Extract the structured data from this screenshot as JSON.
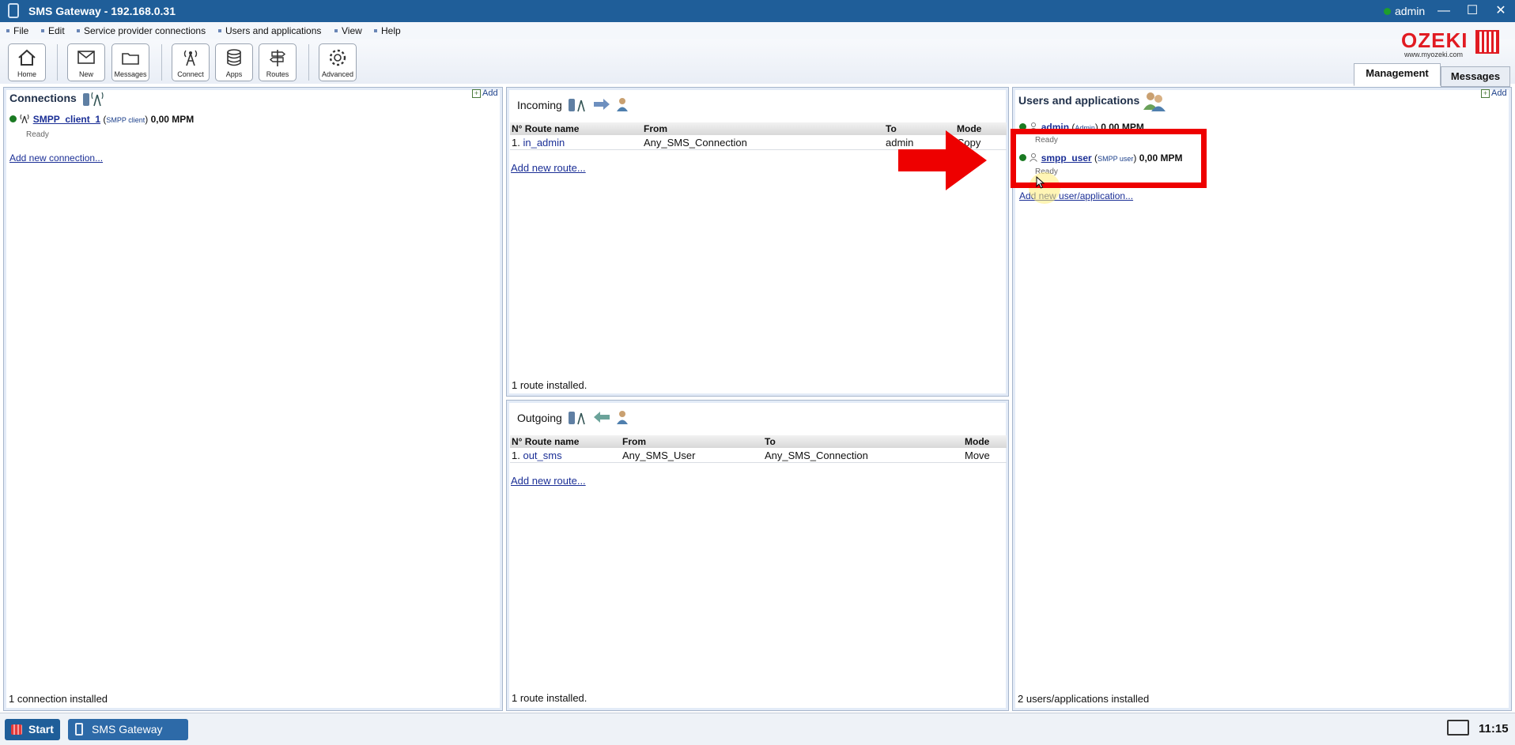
{
  "window": {
    "title": "SMS Gateway - 192.168.0.31",
    "user": "admin",
    "minimize": "—",
    "maximize": "☐",
    "close": "✕"
  },
  "menu": [
    "File",
    "Edit",
    "Service provider connections",
    "Users and applications",
    "View",
    "Help"
  ],
  "toolbar": {
    "home": "Home",
    "new": "New",
    "messages": "Messages",
    "connect": "Connect",
    "apps": "Apps",
    "routes": "Routes",
    "advanced": "Advanced"
  },
  "logo": {
    "word": "OZEKI",
    "url": "www.myozeki.com"
  },
  "tabs": {
    "management": "Management",
    "messages": "Messages"
  },
  "connections": {
    "title": "Connections",
    "add": "Add",
    "item": {
      "name": "SMPP_client_1",
      "type": "SMPP client",
      "rate": "0,00 MPM",
      "status": "Ready"
    },
    "add_new": "Add new connection...",
    "footer": "1 connection installed"
  },
  "incoming": {
    "title": "Incoming",
    "headers": [
      "N° Route name",
      "From",
      "To",
      "Mode"
    ],
    "row": {
      "n": "1.",
      "name": "in_admin",
      "from": "Any_SMS_Connection",
      "to": "admin",
      "mode": "Copy"
    },
    "add_new": "Add new route...",
    "footer": "1 route installed."
  },
  "outgoing": {
    "title": "Outgoing",
    "headers": [
      "N° Route name",
      "From",
      "To",
      "Mode"
    ],
    "row": {
      "n": "1.",
      "name": "out_sms",
      "from": "Any_SMS_User",
      "to": "Any_SMS_Connection",
      "mode": "Move"
    },
    "add_new": "Add new route...",
    "footer": "1 route installed."
  },
  "users": {
    "title": "Users and applications",
    "add": "Add",
    "admin": {
      "name": "admin",
      "type": "Admin",
      "rate": "0,00 MPM",
      "status": "Ready"
    },
    "smpp": {
      "name": "smpp_user",
      "type": "SMPP user",
      "rate": "0,00 MPM",
      "status": "Ready"
    },
    "add_new": "Add new user/application...",
    "footer": "2 users/applications installed"
  },
  "taskbar": {
    "start": "Start",
    "app": "SMS Gateway",
    "clock": "11:15"
  },
  "colors": {
    "accent": "#1f5e99",
    "highlight": "#ee0000",
    "status_ok": "#1a7a22"
  }
}
